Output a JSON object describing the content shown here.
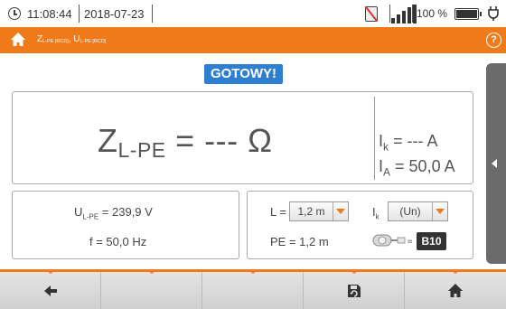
{
  "status": {
    "time": "11:08:44",
    "date": "2018-07-23",
    "battery": "100 %",
    "battery_level": 1.0
  },
  "header": {
    "title_z": "Z",
    "title_z_sub": "L-PE [RCD]",
    "title_sep": ", ",
    "title_u": "U",
    "title_u_sub": "L-PE [RCD]",
    "help": "?"
  },
  "ready_label": "GOTOWY!",
  "result": {
    "z_symbol": "Z",
    "z_sub": "L-PE",
    "z_value": " = --- Ω",
    "ik_symbol": "I",
    "ik_sub": "k",
    "ik_value": " = --- A",
    "ia_symbol": "I",
    "ia_sub": "A",
    "ia_value": " = 50,0 A"
  },
  "measurements": {
    "u_symbol": "U",
    "u_sub": "L-PE",
    "u_value": " = 239,9 V",
    "freq": "f = 50,0 Hz"
  },
  "settings": {
    "l_label": "L =",
    "l_value": "1,2 m",
    "ik_symbol": "I",
    "ik_sub": "k",
    "ik_value": "(Un)",
    "pe_label": "PE = 1,2 m",
    "fuse_eq": "=",
    "fuse": "B10"
  },
  "colors": {
    "accent": "#ef7a1a",
    "ready": "#2f7fd1",
    "fuse_badge": "#333333"
  },
  "toolbar": {
    "icons": [
      "back-arrow-icon",
      "save-memory-icon",
      "home-icon"
    ]
  }
}
